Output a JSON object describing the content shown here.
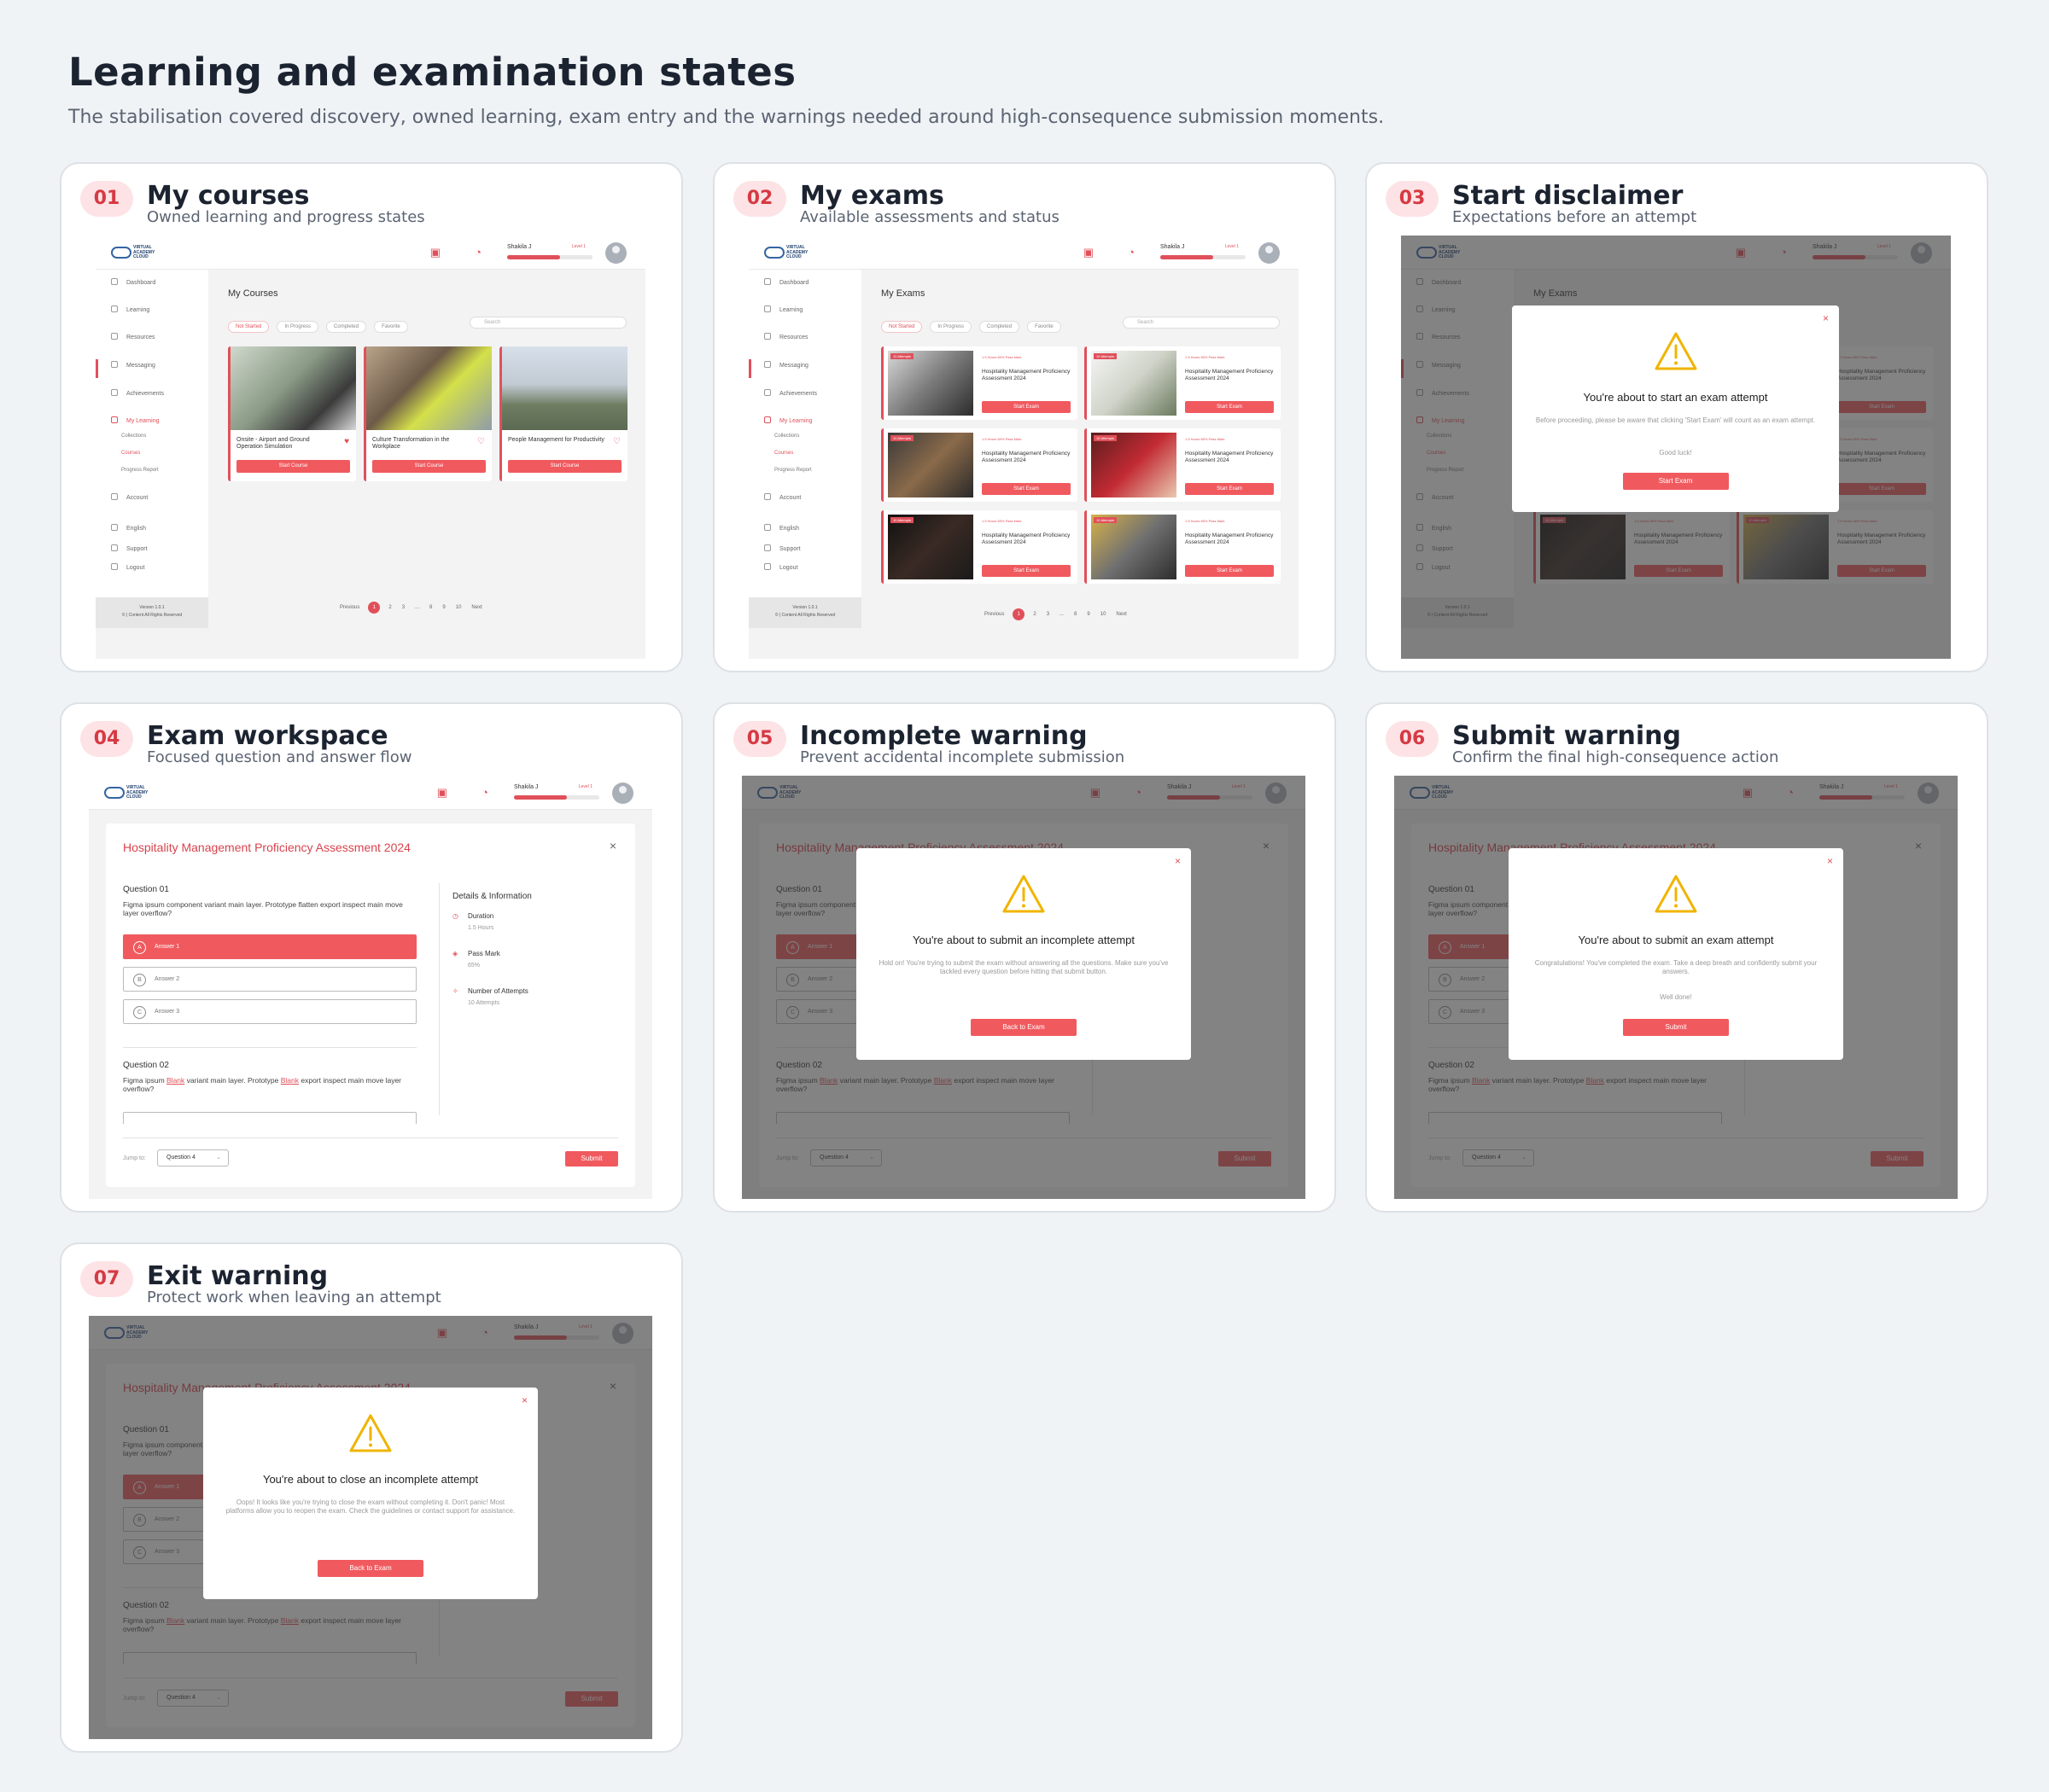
{
  "page": {
    "title": "Learning and examination states",
    "subtitle": "The stabilisation covered discovery, owned learning, exam entry and the warnings needed around high-consequence submission moments."
  },
  "cards": [
    {
      "num": "01",
      "title": "My courses",
      "sub": "Owned learning and progress states"
    },
    {
      "num": "02",
      "title": "My exams",
      "sub": "Available assessments and status"
    },
    {
      "num": "03",
      "title": "Start disclaimer",
      "sub": "Expectations before an attempt"
    },
    {
      "num": "04",
      "title": "Exam workspace",
      "sub": "Focused question and answer flow"
    },
    {
      "num": "05",
      "title": "Incomplete warning",
      "sub": "Prevent accidental incomplete submission"
    },
    {
      "num": "06",
      "title": "Submit warning",
      "sub": "Confirm the final high-consequence action"
    },
    {
      "num": "07",
      "title": "Exit warning",
      "sub": "Protect work when leaving an attempt"
    }
  ],
  "app": {
    "logo": "VIRTUAL\nACADEMY\nCLOUD",
    "user": "Shakila J",
    "level": "Level 1",
    "xp_fraction": 0.62,
    "nav": [
      "Dashboard",
      "Learning",
      "Resources",
      "Messaging",
      "Achievements",
      "My Learning",
      "Account",
      "English",
      "Support",
      "Logout"
    ],
    "nav_sub": [
      "Collections",
      "Courses",
      "Progress Report"
    ],
    "version": "Version 1.0.1",
    "copyright": "© | Content All Rights Reserved",
    "filters": [
      "Not Started",
      "In Progress",
      "Completed",
      "Favorite"
    ],
    "search_placeholder": "Search",
    "pager": {
      "prev": "Previous",
      "pages": [
        "1",
        "2",
        "3",
        "...",
        "8",
        "9",
        "10"
      ],
      "next": "Next"
    }
  },
  "courses": {
    "title": "My Courses",
    "items": [
      {
        "title": "Onsite - Airport and Ground Operation Simulation",
        "button": "Start Course"
      },
      {
        "title": "Culture Transformation in the Workplace",
        "button": "Start Course"
      },
      {
        "title": "People Management for Productivity",
        "button": "Start Course"
      }
    ]
  },
  "exams": {
    "title": "My Exams",
    "tag": "10 Attempts",
    "meta": "1.5 Hours   65% Pass Mark",
    "item_title": "Hospitality Management Proficiency Assessment 2024",
    "button": "Start Exam"
  },
  "workspace": {
    "title": "Hospitality Management Proficiency Assessment 2024",
    "q1_label": "Question 01",
    "q1_text": "Figma ipsum component variant main layer. Prototype flatten export inspect main move layer overflow?",
    "answers": [
      {
        "letter": "A",
        "text": "Answer 1"
      },
      {
        "letter": "B",
        "text": "Answer 2"
      },
      {
        "letter": "C",
        "text": "Answer 3"
      }
    ],
    "q2_label": "Question 02",
    "q2_part1": "Figma ipsum ",
    "q2_blank1": "Blank",
    "q2_part2": " variant main layer. Prototype ",
    "q2_blank2": "Blank",
    "q2_part3": " export inspect main move layer overflow?",
    "details_title": "Details & Information",
    "details": [
      {
        "label": "Duration",
        "value": "1.5 Hours"
      },
      {
        "label": "Pass Mark",
        "value": "65%"
      },
      {
        "label": "Number of Attempts",
        "value": "10 Attempts"
      }
    ],
    "jump_label": "Jump to:",
    "jump_value": "Question 4",
    "submit": "Submit"
  },
  "modals": {
    "start": {
      "title": "You're about to start an exam attempt",
      "body": "Before proceeding, please be aware that clicking 'Start Exam' will count as an exam attempt.",
      "extra": "Good luck!",
      "button": "Start Exam"
    },
    "incomplete": {
      "title": "You're about to submit an incomplete attempt",
      "body": "Hold on! You're trying to submit the exam without answering all the questions. Make sure you've tackled every question before hitting that submit button.",
      "button": "Back to Exam"
    },
    "submit": {
      "title": "You're about to submit an exam attempt",
      "body": "Congratulations! You've completed the exam. Take a deep breath and confidently submit your answers.",
      "extra": "Well done!",
      "button": "Submit"
    },
    "exit": {
      "title": "You're about to close an incomplete attempt",
      "body": "Oops! It looks like you're trying to close the exam without completing it. Don't panic! Most platforms allow you to reopen the exam. Check the guidelines or contact support for assistance.",
      "button": "Back to Exam"
    }
  },
  "colors": {
    "accent": "#f05a5f",
    "badge_bg": "#fde3e5",
    "warning": "#f0b400"
  }
}
